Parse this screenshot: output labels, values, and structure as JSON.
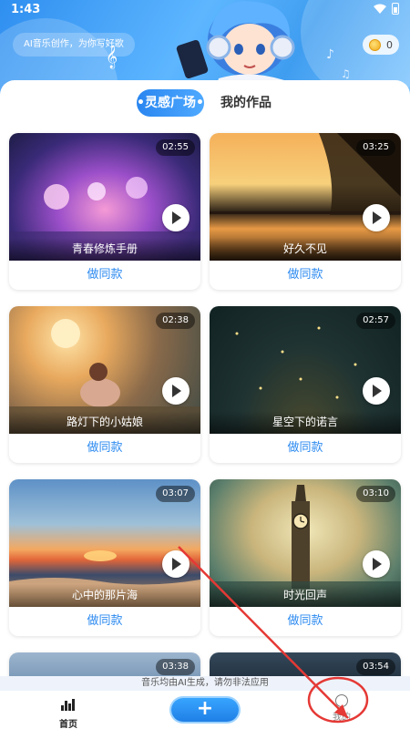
{
  "status": {
    "time": "1:43"
  },
  "header": {
    "slogan": "AI音乐创作，为你写好歌",
    "coins": "0"
  },
  "tabs": [
    {
      "label": "•灵感广场•",
      "active": true
    },
    {
      "label": "我的作品",
      "active": false
    }
  ],
  "cards": [
    {
      "title": "青春修炼手册",
      "duration": "02:55",
      "action": "做同款"
    },
    {
      "title": "好久不见",
      "duration": "03:25",
      "action": "做同款"
    },
    {
      "title": "路灯下的小姑娘",
      "duration": "02:38",
      "action": "做同款"
    },
    {
      "title": "星空下的诺言",
      "duration": "02:57",
      "action": "做同款"
    },
    {
      "title": "心中的那片海",
      "duration": "03:07",
      "action": "做同款"
    },
    {
      "title": "时光回声",
      "duration": "03:10",
      "action": "做同款"
    },
    {
      "title": "",
      "duration": "03:38",
      "action": ""
    },
    {
      "title": "",
      "duration": "03:54",
      "action": ""
    }
  ],
  "footer": {
    "notice": "音乐均由AI生成，请勿非法应用",
    "home_label": "首页",
    "create_label": "+",
    "mine_label": "我的"
  },
  "colors": {
    "accent": "#2c8af0",
    "annotation": "#e53935"
  }
}
